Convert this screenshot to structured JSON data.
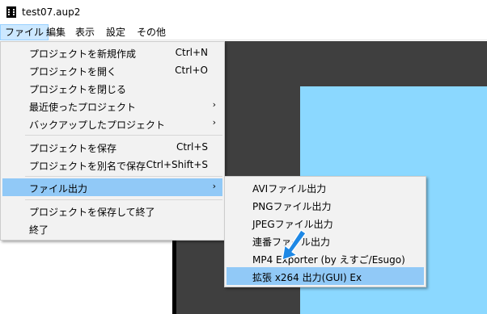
{
  "window": {
    "title": "test07.aup2",
    "icon": "film-strip-icon"
  },
  "menubar": {
    "items": [
      {
        "label": "ファイル"
      },
      {
        "label": "編集"
      },
      {
        "label": "表示"
      },
      {
        "label": "設定"
      },
      {
        "label": "その他"
      }
    ]
  },
  "file_menu": {
    "items": [
      {
        "label": "プロジェクトを新規作成",
        "shortcut": "Ctrl+N"
      },
      {
        "label": "プロジェクトを開く",
        "shortcut": "Ctrl+O"
      },
      {
        "label": "プロジェクトを閉じる",
        "shortcut": ""
      },
      {
        "label": "最近使ったプロジェクト",
        "shortcut": ""
      },
      {
        "label": "バックアップしたプロジェクト",
        "shortcut": ""
      },
      {
        "label": "プロジェクトを保存",
        "shortcut": "Ctrl+S"
      },
      {
        "label": "プロジェクトを別名で保存",
        "shortcut": "Ctrl+Shift+S"
      },
      {
        "label": "ファイル出力",
        "shortcut": ""
      },
      {
        "label": "プロジェクトを保存して終了",
        "shortcut": ""
      },
      {
        "label": "終了",
        "shortcut": ""
      }
    ],
    "submenu_arrow": "›"
  },
  "export_submenu": {
    "items": [
      {
        "label": "AVIファイル出力"
      },
      {
        "label": "PNGファイル出力"
      },
      {
        "label": "JPEGファイル出力"
      },
      {
        "label": "連番ファイル出力"
      },
      {
        "label": "MP4 Exporter (by えすご/Esugo)"
      },
      {
        "label": "拡張 x264 出力(GUI) Ex"
      }
    ]
  },
  "colors": {
    "highlight": "#91c9f7",
    "menu_background": "#f2f2f2",
    "canvas_dark": "#3f3f3f",
    "canvas_light": "#8bd8ff",
    "pointer_arrow": "#1e88e5"
  },
  "annotation": {
    "icon": "pointer-arrow-icon"
  }
}
